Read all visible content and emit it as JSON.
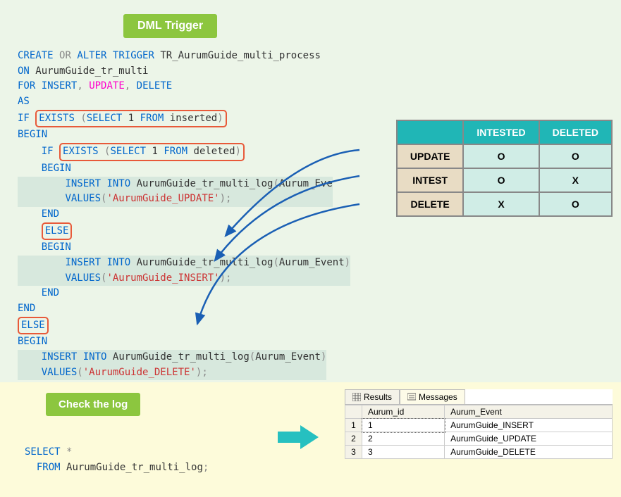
{
  "badges": {
    "dml": "DML Trigger",
    "check": "Check the log"
  },
  "sql": {
    "create": "CREATE",
    "or": "OR",
    "alter": "ALTER",
    "trigger": "TRIGGER",
    "trigger_name": "TR_AurumGuide_multi_process",
    "on": "ON",
    "table": "AurumGuide_tr_multi",
    "for": "FOR",
    "insert": "INSERT",
    "comma": ",",
    "update": "UPDATE",
    "delete": "DELETE",
    "as": "AS",
    "if": "IF",
    "exists": "EXISTS",
    "lparen": "(",
    "rparen": ")",
    "select": "SELECT",
    "one": "1",
    "from": "FROM",
    "inserted": "inserted",
    "deleted": "deleted",
    "begin": "BEGIN",
    "end": "END",
    "else": "ELSE",
    "semi": ";",
    "into": "INTO",
    "log_tbl": "AurumGuide_tr_multi_log",
    "ev_col": "Aurum_Event",
    "ev_col_trunc": "Aurum_Eve",
    "values": "VALUES",
    "str_update": "'AurumGuide_UPDATE'",
    "str_insert": "'AurumGuide_INSERT'",
    "str_delete": "'AurumGuide_DELETE'"
  },
  "truth": {
    "hdr_intested": "INTESTED",
    "hdr_deleted": "DELETED",
    "rows": [
      {
        "label": "UPDATE",
        "intested": "O",
        "deleted": "O"
      },
      {
        "label": "INTEST",
        "intested": "O",
        "deleted": "X"
      },
      {
        "label": "DELETE",
        "intested": "X",
        "deleted": "O"
      }
    ]
  },
  "select_query": {
    "select": "SELECT",
    "star": "*",
    "from": "FROM",
    "table": "AurumGuide_tr_multi_log",
    "semi": ";"
  },
  "results": {
    "tab_results": "Results",
    "tab_messages": "Messages",
    "cols": {
      "c1": "Aurum_id",
      "c2": "Aurum_Event"
    },
    "rows": [
      {
        "rn": "1",
        "id": "1",
        "ev": "AurumGuide_INSERT"
      },
      {
        "rn": "2",
        "id": "2",
        "ev": "AurumGuide_UPDATE"
      },
      {
        "rn": "3",
        "id": "3",
        "ev": "AurumGuide_DELETE"
      }
    ]
  }
}
